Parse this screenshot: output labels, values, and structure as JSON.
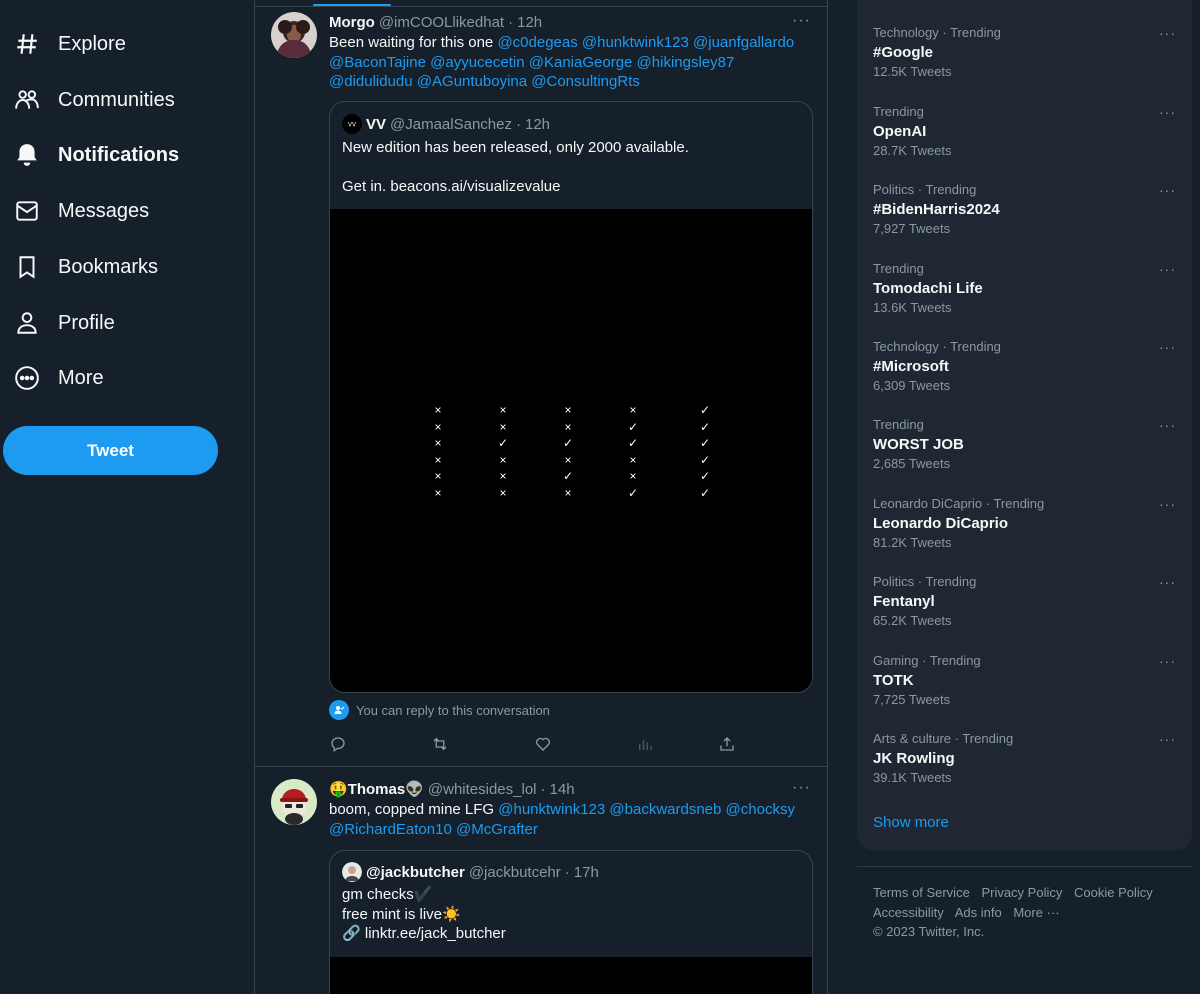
{
  "nav": {
    "items": [
      {
        "label": "Explore",
        "icon": "hashtag-icon"
      },
      {
        "label": "Communities",
        "icon": "communities-icon"
      },
      {
        "label": "Notifications",
        "icon": "bell-icon"
      },
      {
        "label": "Messages",
        "icon": "envelope-icon"
      },
      {
        "label": "Bookmarks",
        "icon": "bookmark-icon"
      },
      {
        "label": "Profile",
        "icon": "person-icon"
      },
      {
        "label": "More",
        "icon": "more-circle-icon"
      }
    ],
    "tweet_button": "Tweet"
  },
  "tweets": [
    {
      "display_name": "Morgo",
      "handle": "@imCOOLlikedhat",
      "separator": "·",
      "time": "12h",
      "text_prefix": "Been waiting for this one ",
      "mentions": [
        "@c0degeas",
        "@hunktwink123",
        "@juanfgallardo",
        "@BaconTajine",
        "@ayyucecetin",
        "@KaniaGeorge",
        "@hikingsley87",
        "@didulidudu",
        "@AGuntuboyina",
        "@ConsultingRts"
      ],
      "quote": {
        "display_name": "VV",
        "handle": "@JamaalSanchez",
        "separator": "·",
        "time": "12h",
        "avatar_text": "VV",
        "line1": "New edition has been released, only 2000 available.",
        "line2": "Get in. beacons.ai/visualizevalue",
        "media_grid": [
          [
            "x",
            "x",
            "x",
            "x",
            "x",
            "x"
          ],
          [
            "x",
            "x",
            "check",
            "x",
            "x",
            "x"
          ],
          [
            "x",
            "x",
            "check",
            "x",
            "check",
            "x"
          ],
          [
            "x",
            "check",
            "check",
            "x",
            "x",
            "check"
          ],
          [
            "check",
            "check",
            "check",
            "check",
            "check",
            "check"
          ]
        ]
      },
      "reply_note": "You can reply to this conversation"
    },
    {
      "display_name_prefix": "🤑",
      "display_name": "Thomas",
      "display_name_suffix": "👽",
      "handle": "@whitesides_lol",
      "separator": "·",
      "time": "14h",
      "text_prefix": "boom, copped mine LFG ",
      "mentions": [
        "@hunktwink123",
        "@backwardsneb",
        "@chocksy",
        "@RichardEaton10",
        "@McGrafter"
      ],
      "quote": {
        "display_name": "@jackbutcher",
        "handle": "@jackbutcehr",
        "separator": "·",
        "time": "17h",
        "line1": "gm checks",
        "line1_emoji": "✔️",
        "line2": "free mint is live",
        "line2_emoji": "☀️",
        "line3_emoji": "🔗",
        "line3": "linktr.ee/jack_butcher"
      }
    }
  ],
  "trends": [
    {
      "context": "Technology · Trending",
      "name": "#Google",
      "count": "12.5K Tweets"
    },
    {
      "context": "Trending",
      "name": "OpenAI",
      "count": "28.7K Tweets"
    },
    {
      "context": "Politics · Trending",
      "name": "#BidenHarris2024",
      "count": "7,927 Tweets"
    },
    {
      "context": "Trending",
      "name": "Tomodachi Life",
      "count": "13.6K Tweets"
    },
    {
      "context": "Technology · Trending",
      "name": "#Microsoft",
      "count": "6,309 Tweets"
    },
    {
      "context": "Trending",
      "name": "WORST JOB",
      "count": "2,685 Tweets"
    },
    {
      "context": "Leonardo DiCaprio · Trending",
      "name": "Leonardo DiCaprio",
      "count": "81.2K Tweets"
    },
    {
      "context": "Politics · Trending",
      "name": "Fentanyl",
      "count": "65.2K Tweets"
    },
    {
      "context": "Gaming · Trending",
      "name": "TOTK",
      "count": "7,725 Tweets"
    },
    {
      "context": "Arts & culture · Trending",
      "name": "JK Rowling",
      "count": "39.1K Tweets"
    }
  ],
  "show_more": "Show more",
  "footer": {
    "links": [
      "Terms of Service",
      "Privacy Policy",
      "Cookie Policy",
      "Accessibility",
      "Ads info",
      "More ···"
    ],
    "copyright": "© 2023 Twitter, Inc."
  },
  "more_glyph": "···",
  "colors": {
    "background": "#15202b",
    "accent": "#1d9bf0",
    "card": "#1e2732",
    "border": "#38444d",
    "muted": "#8b98a5"
  }
}
